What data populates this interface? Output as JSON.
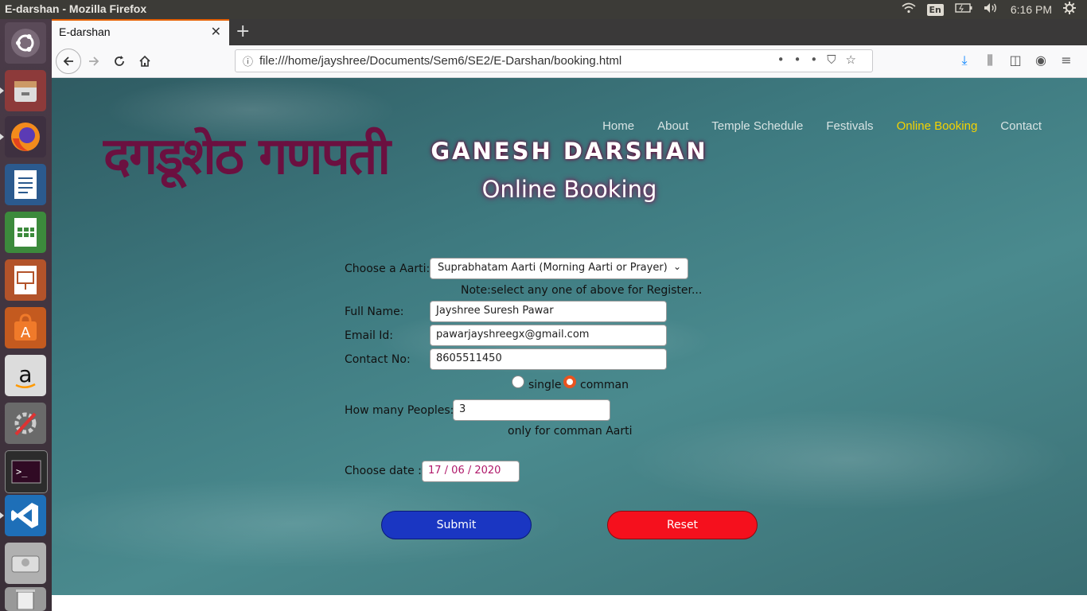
{
  "system": {
    "window_title": "E-darshan - Mozilla Firefox",
    "keyboard": "En",
    "clock": "6:16 PM"
  },
  "browser": {
    "tab_title": "E-darshan",
    "url": "file:///home/jayshree/Documents/Sem6/SE2/E-Darshan/booking.html"
  },
  "site": {
    "logo_text": "दगडूशेठ गणपती",
    "nav": [
      "Home",
      "About",
      "Temple Schedule",
      "Festivals",
      "Online Booking",
      "Contact"
    ],
    "brand": "GANESH DARSHAN",
    "heading": "Online Booking"
  },
  "form": {
    "aarti_label": "Choose a Aarti:",
    "aarti_value": "Suprabhatam Aarti (Morning Aarti or Prayer)",
    "note": "Note:select any one of above for Register...",
    "name_label": "Full Name:",
    "name_value": "Jayshree Suresh Pawar",
    "email_label": "Email Id:",
    "email_value": "pawarjayshreegx@gmail.com",
    "contact_label": "Contact No:",
    "contact_value": "8605511450",
    "radio_single": "single",
    "radio_comman": "comman",
    "selected_type": "comman",
    "people_label": "How many Peoples:",
    "people_value": "3",
    "people_note": "only for comman Aarti",
    "date_label": "Choose date :",
    "date_value": "17 / 06 / 2020",
    "submit": "Submit",
    "reset": "Reset"
  }
}
